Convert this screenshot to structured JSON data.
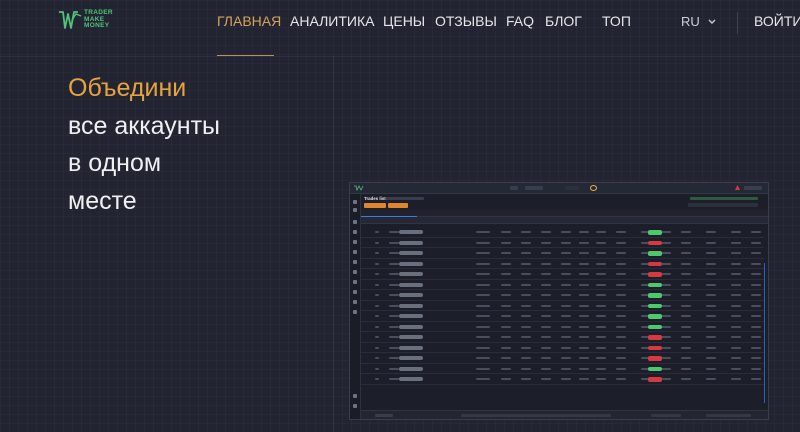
{
  "brand": {
    "line1": "TRADER",
    "line2": "MAKE",
    "line3": "MONEY",
    "color": "#52c27a"
  },
  "nav": {
    "items": [
      {
        "label": "ГЛАВНАЯ",
        "active": true
      },
      {
        "label": "АНАЛИТИКА",
        "active": false
      },
      {
        "label": "ЦЕНЫ",
        "active": false
      },
      {
        "label": "ОТЗЫВЫ",
        "active": false
      },
      {
        "label": "FAQ",
        "active": false
      },
      {
        "label": "БЛОГ",
        "active": false
      },
      {
        "label": "ТОП",
        "active": false
      }
    ],
    "language": "RU",
    "language_icon": "chevron-down-icon",
    "login": "ВОЙТИ",
    "active_color": "#d6a35a"
  },
  "hero": {
    "line1": "Объедини",
    "line2": "все аккаунты",
    "line3": "в одном",
    "line4": "месте",
    "accent_color": "#e8a33d"
  },
  "colors": {
    "background": "#222531",
    "app_orange": "#e0842e",
    "app_green": "#4cc96a",
    "app_red": "#d8383f",
    "app_blue": "#3e7de0"
  },
  "app_preview": {
    "title": "Trades list",
    "status_pills": [
      "green",
      "red",
      "green",
      "red",
      "red",
      "green",
      "green",
      "green",
      "green",
      "green",
      "red",
      "red",
      "red",
      "green",
      "red"
    ]
  }
}
